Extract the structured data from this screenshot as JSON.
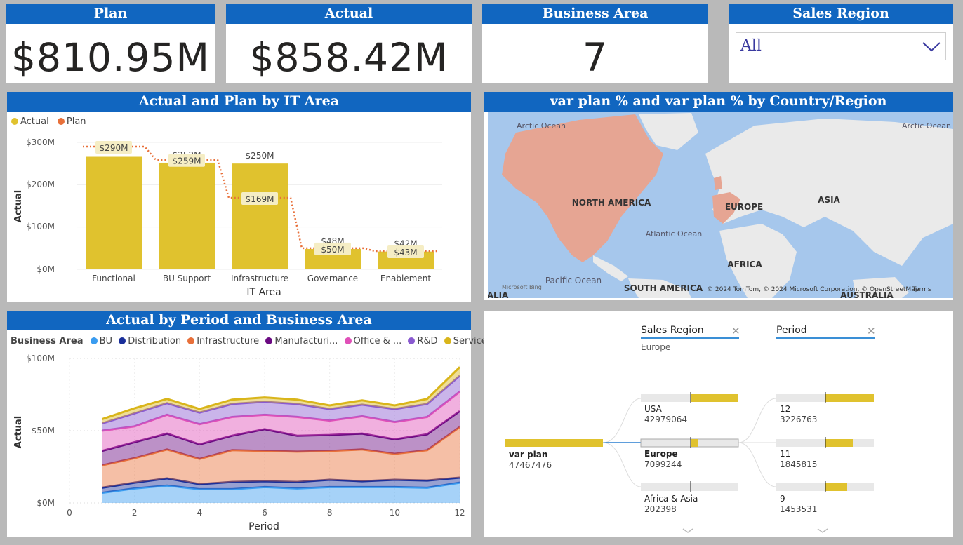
{
  "kpis": {
    "plan": {
      "title": "Plan",
      "value": "$810.95M"
    },
    "actual": {
      "title": "Actual",
      "value": "$858.42M"
    },
    "business_area": {
      "title": "Business Area",
      "value": "7"
    }
  },
  "slicer": {
    "title": "Sales Region",
    "value": "All"
  },
  "colors": {
    "header": "#1166c0",
    "actual": "#e0c22e",
    "plan": "#e8703a"
  },
  "bar_chart": {
    "title": "Actual and Plan by IT Area",
    "legend": [
      "Actual",
      "Plan"
    ],
    "ylabel": "Actual",
    "xlabel": "IT Area",
    "yticks": [
      "$300M",
      "$200M",
      "$100M",
      "$0M"
    ]
  },
  "map": {
    "title": "var plan % and var plan % by Country/Region",
    "labels": {
      "arctic_left": "Arctic Ocean",
      "arctic_right": "Arctic Ocean",
      "north_america": "NORTH AMERICA",
      "europe": "EUROPE",
      "asia": "ASIA",
      "atlantic": "Atlantic Ocean",
      "africa": "AFRICA",
      "pacific": "Pacific Ocean",
      "south_america": "SOUTH AMERICA",
      "australia": "AUSTRALIA",
      "alia": "ALIA",
      "bing": "Microsoft Bing",
      "copyright": "© 2024 TomTom, © 2024 Microsoft Corporation, © OpenStreetMap",
      "terms": "Terms"
    }
  },
  "area_chart": {
    "title": "Actual by Period and Business Area",
    "legend_title": "Business Area",
    "legend": [
      "BU",
      "Distribution",
      "Infrastructure",
      "Manufacturi...",
      "Office & ...",
      "R&D",
      "Services"
    ],
    "ylabel": "Actual",
    "xlabel": "Period",
    "yticks": [
      "$100M",
      "$50M",
      "$0M"
    ],
    "xticks": [
      "0",
      "2",
      "4",
      "6",
      "8",
      "10",
      "12"
    ]
  },
  "decomp": {
    "col1": {
      "header": "Sales Region",
      "filter": "Europe"
    },
    "col2": {
      "header": "Period"
    },
    "root": {
      "label": "var plan",
      "value": "47467476"
    },
    "regions": [
      {
        "label": "USA",
        "value": "42979064"
      },
      {
        "label": "Europe",
        "value": "7099244"
      },
      {
        "label": "Africa & Asia",
        "value": "202398"
      }
    ],
    "periods": [
      {
        "label": "12",
        "value": "3226763"
      },
      {
        "label": "11",
        "value": "1845815"
      },
      {
        "label": "9",
        "value": "1453531"
      }
    ]
  },
  "chart_data": [
    {
      "type": "bar",
      "title": "Actual and Plan by IT Area",
      "categories": [
        "Functional",
        "BU Support",
        "Infrastructure",
        "Governance",
        "Enablement"
      ],
      "series": [
        {
          "name": "Actual",
          "values": [
            266,
            252,
            250,
            48,
            42
          ],
          "labels": [
            "$266M",
            "$252M",
            "$250M",
            "$48M",
            "$42M"
          ]
        },
        {
          "name": "Plan",
          "values": [
            290,
            259,
            169,
            50,
            43
          ],
          "labels": [
            "$290M",
            "$259M",
            "$169M",
            "$50M",
            "$43M"
          ]
        }
      ],
      "xlabel": "IT Area",
      "ylabel": "Actual",
      "ylim": [
        0,
        300
      ],
      "unit": "$M"
    },
    {
      "type": "area",
      "title": "Actual by Period and Business Area",
      "x": [
        1,
        2,
        3,
        4,
        5,
        6,
        7,
        8,
        9,
        10,
        11,
        12
      ],
      "stacked": true,
      "series": [
        {
          "name": "BU",
          "color": "#3a9cf0",
          "values": [
            7,
            10,
            12,
            9.5,
            9.5,
            11,
            10,
            11,
            11,
            11,
            10.5,
            14
          ]
        },
        {
          "name": "Distribution",
          "color": "#1a2f9a",
          "values": [
            3.5,
            4,
            5,
            3.5,
            5,
            4,
            4.5,
            5,
            4,
            5,
            5,
            3.5
          ]
        },
        {
          "name": "Infrastructure",
          "color": "#e8703a",
          "values": [
            15.5,
            17,
            20,
            17.5,
            22,
            21,
            21,
            20,
            22,
            18,
            21,
            35
          ]
        },
        {
          "name": "Manufacturi...",
          "color": "#6b0a82",
          "values": [
            10,
            11,
            11,
            10,
            10,
            15,
            11,
            11,
            11,
            10,
            11,
            11
          ]
        },
        {
          "name": "Office & ...",
          "color": "#e050b8",
          "values": [
            14,
            11,
            13,
            14,
            13,
            10,
            13,
            10,
            12,
            12,
            12,
            13.5
          ]
        },
        {
          "name": "R&D",
          "color": "#8a5ad0",
          "values": [
            5,
            9,
            8,
            8,
            9,
            9,
            9,
            8,
            8,
            9,
            9,
            11
          ]
        },
        {
          "name": "Services",
          "color": "#d9b51a",
          "values": [
            3,
            3.5,
            3,
            2.5,
            3,
            3,
            3,
            2.5,
            3,
            2.5,
            3.5,
            6
          ]
        }
      ],
      "xlabel": "Period",
      "ylabel": "Actual",
      "ylim": [
        0,
        100
      ],
      "xlim": [
        0,
        12
      ],
      "unit": "$M"
    }
  ]
}
